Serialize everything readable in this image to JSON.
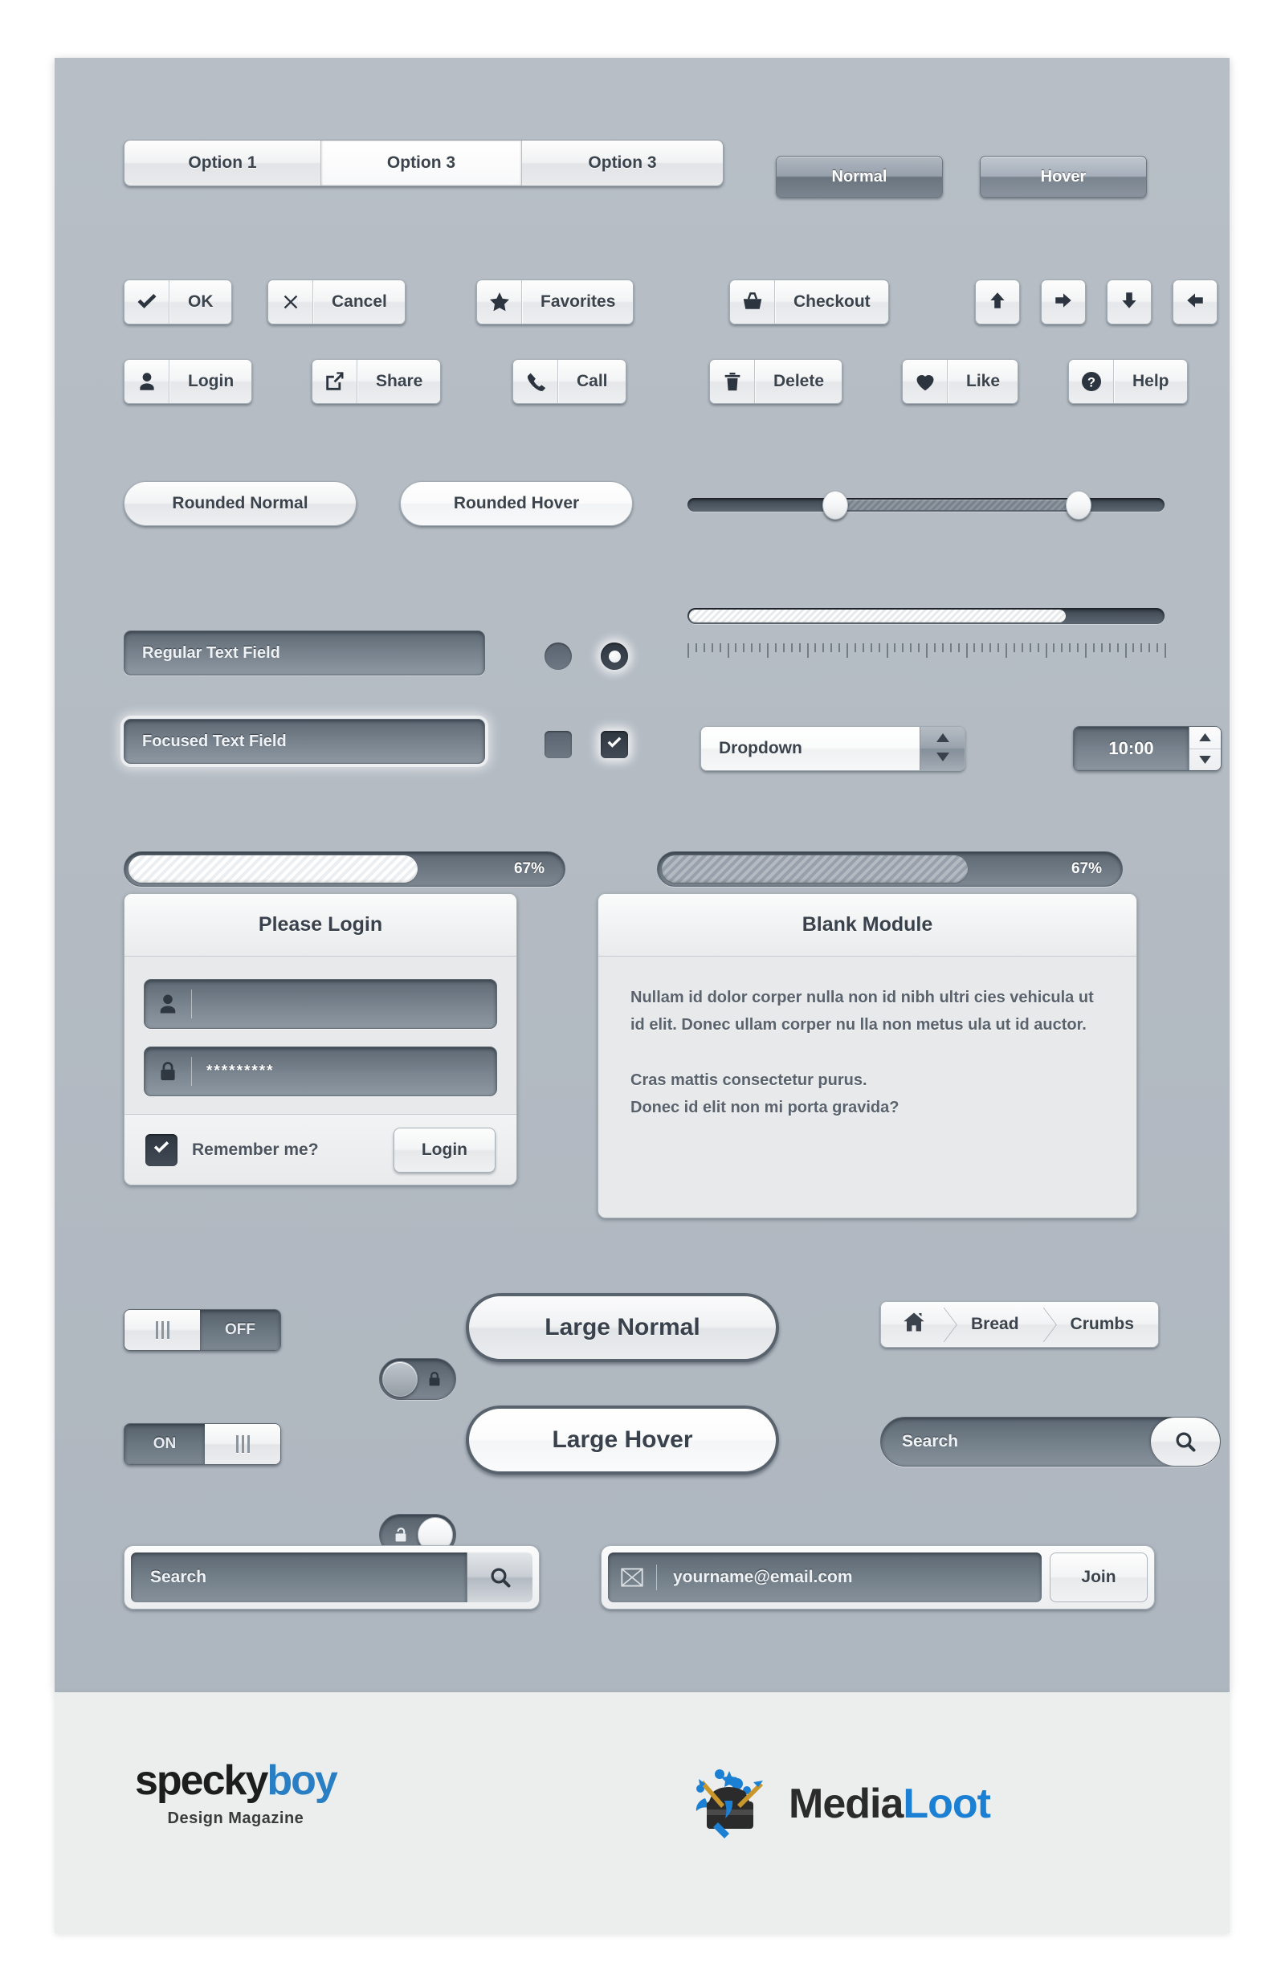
{
  "segmented": {
    "options": [
      {
        "label": "Option 1",
        "active": false
      },
      {
        "label": "Option 3",
        "active": true
      },
      {
        "label": "Option 3",
        "active": false
      }
    ]
  },
  "state_buttons": [
    {
      "label": "Normal",
      "state": "normal"
    },
    {
      "label": "Hover",
      "state": "hover"
    }
  ],
  "icon_buttons_row1": [
    {
      "label": "OK",
      "icon": "check-icon"
    },
    {
      "label": "Cancel",
      "icon": "close-icon"
    },
    {
      "label": "Favorites",
      "icon": "star-icon"
    },
    {
      "label": "Checkout",
      "icon": "basket-icon"
    }
  ],
  "arrow_buttons": [
    {
      "icon": "arrow-up-icon"
    },
    {
      "icon": "arrow-right-icon"
    },
    {
      "icon": "arrow-down-icon"
    },
    {
      "icon": "arrow-left-icon"
    }
  ],
  "icon_buttons_row2": [
    {
      "label": "Login",
      "icon": "user-icon"
    },
    {
      "label": "Share",
      "icon": "share-icon"
    },
    {
      "label": "Call",
      "icon": "phone-icon"
    },
    {
      "label": "Delete",
      "icon": "trash-icon"
    },
    {
      "label": "Like",
      "icon": "heart-icon"
    },
    {
      "label": "Help",
      "icon": "question-icon"
    }
  ],
  "rounded_buttons": [
    {
      "label": "Rounded Normal",
      "state": "normal"
    },
    {
      "label": "Rounded Hover",
      "state": "hover"
    }
  ],
  "text_fields": [
    {
      "value": "Regular Text Field",
      "state": "regular"
    },
    {
      "value": "Focused Text Field",
      "state": "focused"
    }
  ],
  "radios": [
    {
      "state": "unchecked"
    },
    {
      "state": "checked"
    }
  ],
  "checkboxes": [
    {
      "state": "unchecked"
    },
    {
      "state": "checked"
    }
  ],
  "range_slider": {
    "low_percent": 31,
    "high_percent": 82
  },
  "fill_slider": {
    "value_percent": 79,
    "tick_count": 61
  },
  "dropdown": {
    "selected": "Dropdown",
    "up_arrow": "caret-up-icon",
    "down_arrow": "caret-down-icon"
  },
  "time_spinner": {
    "value": "10:00",
    "up_arrow": "caret-up-icon",
    "down_arrow": "caret-down-icon"
  },
  "progress_bars": [
    {
      "percent_label": "67%",
      "percent": 67,
      "style": "light"
    },
    {
      "percent_label": "67%",
      "percent": 67,
      "style": "dark"
    }
  ],
  "login_module": {
    "title": "Please Login",
    "username": {
      "icon": "user-icon",
      "value": ""
    },
    "password": {
      "icon": "lock-icon",
      "value": "*********"
    },
    "remember": {
      "label": "Remember me?",
      "checked": true,
      "icon": "check-icon"
    },
    "submit_label": "Login"
  },
  "blank_module": {
    "title": "Blank Module",
    "paragraph1": "Nullam id dolor corper nulla non id nibh ultri cies vehicula ut id elit. Donec ullam corper nu lla non metus ula ut id auctor.",
    "paragraph2_line1": "Cras mattis consectetur purus.",
    "paragraph2_line2": "Donec id elit non mi porta gravida?"
  },
  "toggles": [
    {
      "label": "OFF",
      "state": "off",
      "handle": "grip-icon"
    },
    {
      "label": "ON",
      "state": "on",
      "handle": "grip-icon"
    }
  ],
  "lock_toggles": [
    {
      "state": "off",
      "icon": "lock-closed-icon"
    },
    {
      "state": "on",
      "icon": "lock-open-icon"
    }
  ],
  "large_buttons": [
    {
      "label": "Large Normal",
      "state": "normal"
    },
    {
      "label": "Large Hover",
      "state": "hover"
    }
  ],
  "breadcrumbs": {
    "items": [
      {
        "label": "",
        "icon": "home-icon"
      },
      {
        "label": "Bread",
        "icon": ""
      },
      {
        "label": "Crumbs",
        "icon": ""
      }
    ]
  },
  "search_pill": {
    "value": "Search",
    "button_icon": "search-icon"
  },
  "search_box": {
    "value": "Search",
    "button_icon": "search-icon"
  },
  "signup_box": {
    "icon": "envelope-icon",
    "value": "yourname@email.com",
    "button_label": "Join"
  },
  "footer": {
    "specky": {
      "part1": "specky",
      "part2": "boy",
      "tagline": "Design Magazine"
    },
    "medialoot": {
      "part1": "Media",
      "part2": "Loot",
      "icon": "treasure-chest-icon"
    }
  },
  "colors": {
    "panel_bg": "#b4bbc3",
    "footer_bg": "#eceeee",
    "dark_control": "#6d7883",
    "ink": "#39424c",
    "accent_blue": "#2a7fc4"
  }
}
